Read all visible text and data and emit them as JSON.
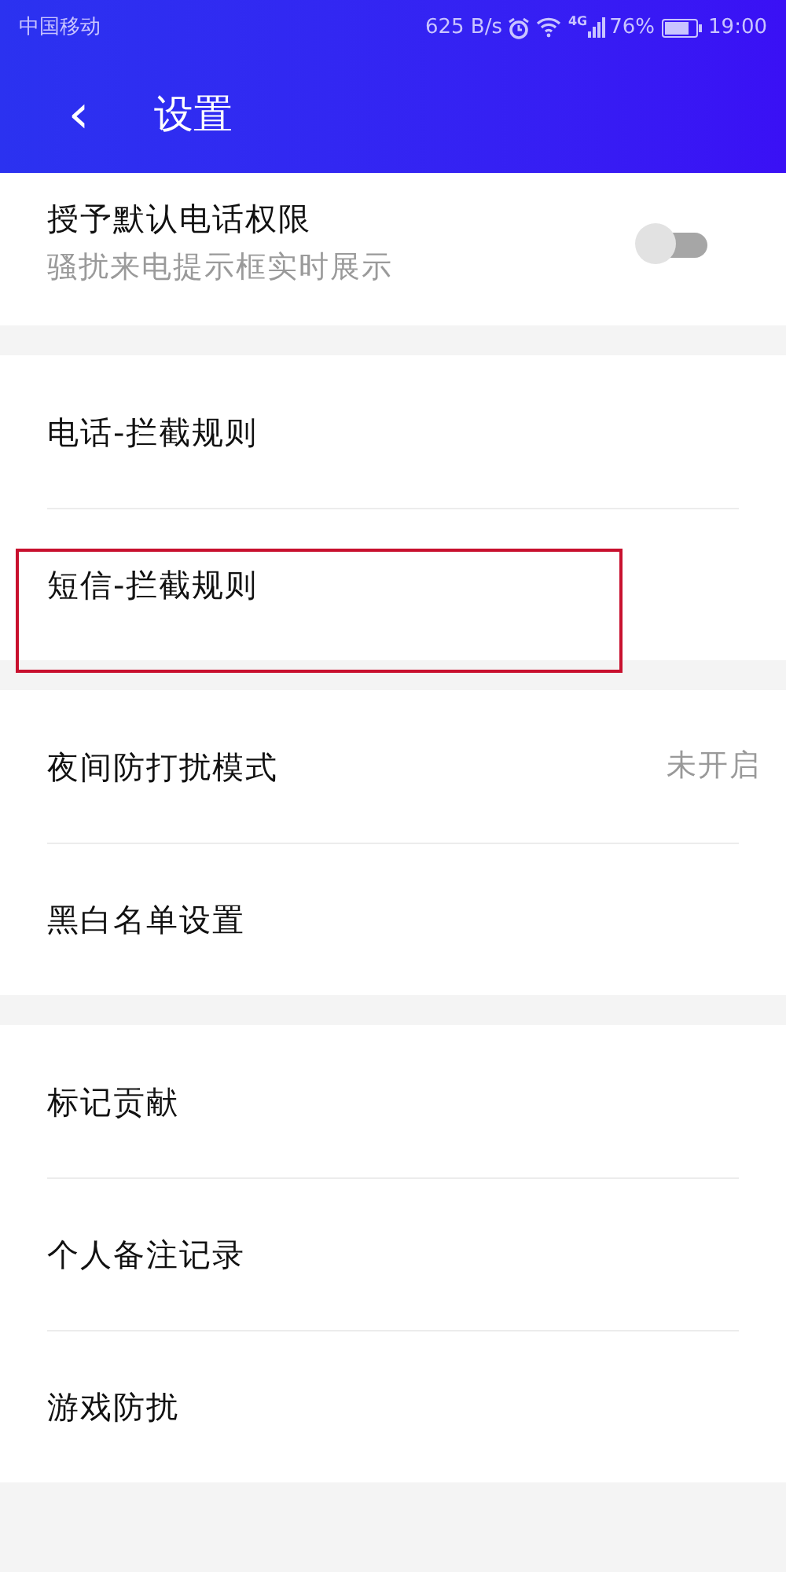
{
  "status_bar": {
    "carrier": "中国移动",
    "speed": "625 B/s",
    "network": "4G",
    "battery": "76%",
    "time": "19:00"
  },
  "header": {
    "back": "‹",
    "title": "设置"
  },
  "sections": [
    {
      "items": [
        {
          "kind": "toggle",
          "label": "授予默认电话权限",
          "subtitle": "骚扰来电提示框实时展示",
          "on": false,
          "highlighted": false
        }
      ]
    },
    {
      "items": [
        {
          "kind": "link",
          "label": "电话-拦截规则",
          "highlighted": false
        },
        {
          "kind": "link",
          "label": "短信-拦截规则",
          "highlighted": true
        }
      ]
    },
    {
      "items": [
        {
          "kind": "value",
          "label": "夜间防打扰模式",
          "value": "未开启",
          "highlighted": false
        },
        {
          "kind": "link",
          "label": "黑白名单设置",
          "highlighted": false
        }
      ]
    },
    {
      "items": [
        {
          "kind": "link",
          "label": "标记贡献",
          "highlighted": false
        },
        {
          "kind": "link",
          "label": "个人备注记录",
          "highlighted": false
        },
        {
          "kind": "link",
          "label": "游戏防扰",
          "highlighted": false
        }
      ]
    }
  ]
}
